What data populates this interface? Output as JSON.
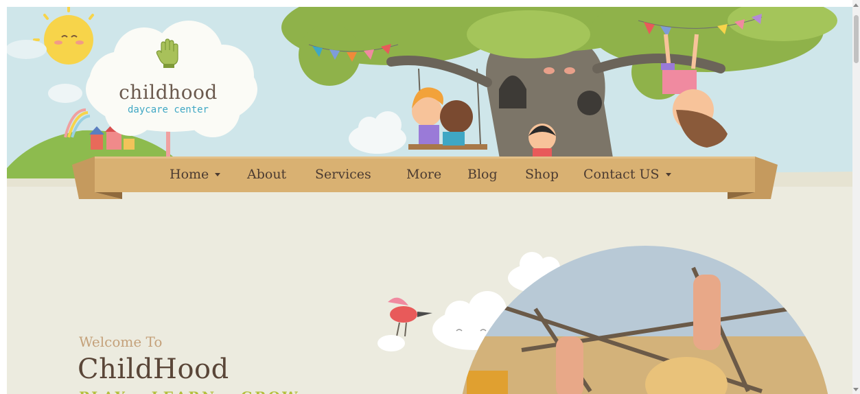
{
  "logo": {
    "name": "childhood",
    "tagline": "daycare center",
    "icon": "hand-icon"
  },
  "nav": {
    "items": [
      {
        "label": "Home",
        "has_dropdown": true
      },
      {
        "label": "About",
        "has_dropdown": false
      },
      {
        "label": "Services",
        "has_dropdown": false
      },
      {
        "label": "More",
        "has_dropdown": false
      },
      {
        "label": "Blog",
        "has_dropdown": false
      },
      {
        "label": "Shop",
        "has_dropdown": false
      },
      {
        "label": "Contact US",
        "has_dropdown": true
      }
    ]
  },
  "hero": {
    "welcome": "Welcome To",
    "headline": "ChildHood",
    "subline": "PLAY • LEARN • GROW"
  },
  "colors": {
    "sky": "#cfe6ea",
    "page_bg": "#ecebdf",
    "ribbon": "#d9b172",
    "ribbon_dark": "#b98f57",
    "nav_text": "#4b3b31",
    "accent_blue": "#3fa7c4",
    "welcome_gold": "#c4a17a",
    "tree_green": "#8fb24a"
  }
}
